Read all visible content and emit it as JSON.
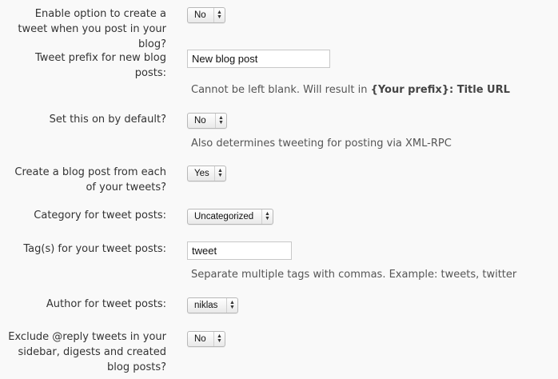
{
  "settings": {
    "create_tweet": {
      "label": "Enable option to create a tweet when you post in your blog?",
      "value": "No"
    },
    "tweet_prefix": {
      "label": "Tweet prefix for new blog posts:",
      "value": "New blog post",
      "note_prefix": "Cannot be left blank. Will result in ",
      "note_bold": "{Your prefix}: Title URL"
    },
    "default_on": {
      "label": "Set this on by default?",
      "value": "No",
      "note": "Also determines tweeting for posting via XML-RPC"
    },
    "create_post": {
      "label": "Create a blog post from each of your tweets?",
      "value": "Yes"
    },
    "category": {
      "label": "Category for tweet posts:",
      "value": "Uncategorized"
    },
    "tags": {
      "label": "Tag(s) for your tweet posts:",
      "value": "tweet",
      "note": "Separate multiple tags with commas. Example: tweets, twitter"
    },
    "author": {
      "label": "Author for tweet posts:",
      "value": "niklas"
    },
    "exclude_replies": {
      "label": "Exclude @reply tweets in your sidebar, digests and created blog posts?",
      "value": "No"
    }
  }
}
